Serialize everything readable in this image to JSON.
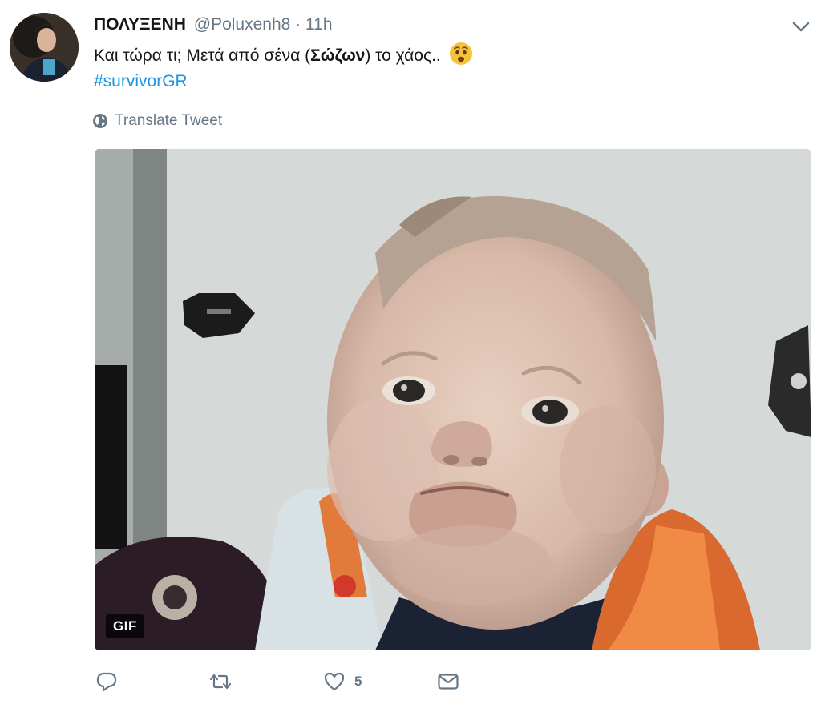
{
  "tweet": {
    "display_name": "ΠΟΛΥΞΕΝΗ",
    "handle": "@Poluxenh8",
    "separator": "·",
    "time": "11h",
    "text_before": "Και τώρα τι; Μετά από σένα (",
    "text_bold": "Σώζων",
    "text_after": ") το χάος..",
    "emoji": "worried-face-emoji",
    "hashtag": "#survivorGR",
    "translate_label": "Translate Tweet",
    "media_badge": "GIF"
  },
  "actions": {
    "reply_icon": "reply-icon",
    "retweet_icon": "retweet-icon",
    "like_icon": "heart-icon",
    "like_count": "5",
    "message_icon": "envelope-icon"
  },
  "colors": {
    "text": "#14171a",
    "secondary": "#657786",
    "link": "#1b95e0",
    "emoji": "#f5c33b"
  }
}
